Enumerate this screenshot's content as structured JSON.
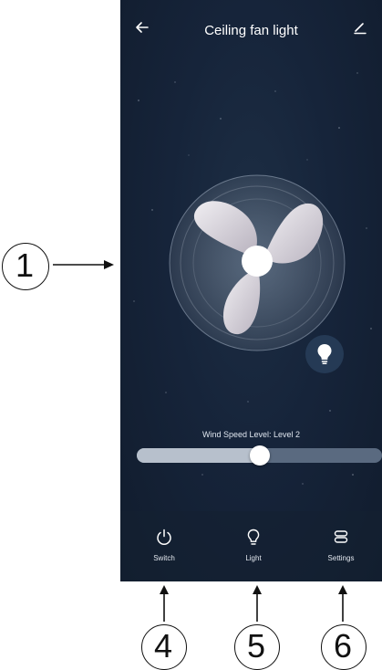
{
  "header": {
    "title": "Ceiling fan light",
    "back_icon": "arrow-left-icon",
    "edit_icon": "pencil-icon"
  },
  "fan": {
    "icon": "fan-icon",
    "light_button_icon": "lightbulb-icon"
  },
  "speed": {
    "label": "Wind Speed Level: Level 2",
    "level_fraction": 0.5
  },
  "bottom_nav": [
    {
      "label": "Switch",
      "icon": "power-icon"
    },
    {
      "label": "Light",
      "icon": "lightbulb-outline-icon"
    },
    {
      "label": "Settings",
      "icon": "settings-icon"
    }
  ],
  "annotations": {
    "left": "1",
    "bottom": [
      "4",
      "5",
      "6"
    ]
  },
  "colors": {
    "background": "#16243a",
    "accent": "#ffffff",
    "annotation": "#111111"
  }
}
